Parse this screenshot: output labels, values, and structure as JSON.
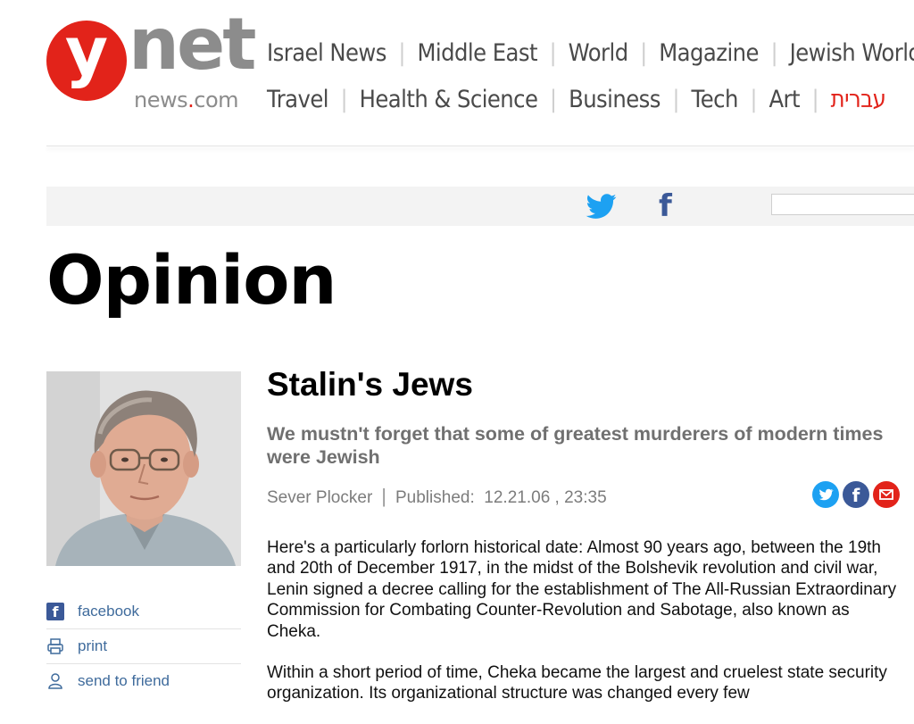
{
  "logo": {
    "mark": "y",
    "net": "net",
    "domain_main": "news",
    "domain_dot": ".",
    "domain_tld": "com"
  },
  "nav": {
    "row1": [
      "Israel News",
      "Middle East",
      "World",
      "Magazine",
      "Jewish World"
    ],
    "row2": [
      "Travel",
      "Health & Science",
      "Business",
      "Tech",
      "Art",
      "עברית"
    ]
  },
  "share_bar": {
    "icons": [
      "twitter-icon",
      "facebook-icon"
    ],
    "search_value": ""
  },
  "section": {
    "title": "Opinion"
  },
  "sidebar": {
    "tools": [
      {
        "label": "facebook",
        "icon": "facebook-icon"
      },
      {
        "label": "print",
        "icon": "printer-icon"
      },
      {
        "label": "send to friend",
        "icon": "person-icon"
      }
    ]
  },
  "article": {
    "headline": "Stalin's Jews",
    "subhead": "We mustn't forget that some of greatest murderers of modern times were Jewish",
    "author": "Sever Plocker",
    "published_label": "Published:",
    "published_value": "12.21.06 , 23:35",
    "share_icons": [
      "twitter-icon",
      "facebook-icon",
      "mail-icon"
    ],
    "paragraphs": [
      "Here's a particularly forlorn historical date: Almost 90 years ago, between the 19th and 20th of December 1917, in the midst of the Bolshevik revolution and civil war, Lenin signed a decree calling for the establishment of The All-Russian Extraordinary Commission for Combating Counter-Revolution and Sabotage, also known as Cheka.",
      "Within a short period of time, Cheka became the largest and cruelest state security organization. Its organizational structure was changed every few"
    ]
  },
  "colors": {
    "brand_red": "#e2231a",
    "nav_gray": "#4a4a4a",
    "link_blue": "#3f6b9c",
    "facebook_blue": "#3b5998",
    "twitter_blue": "#1da1f2"
  }
}
